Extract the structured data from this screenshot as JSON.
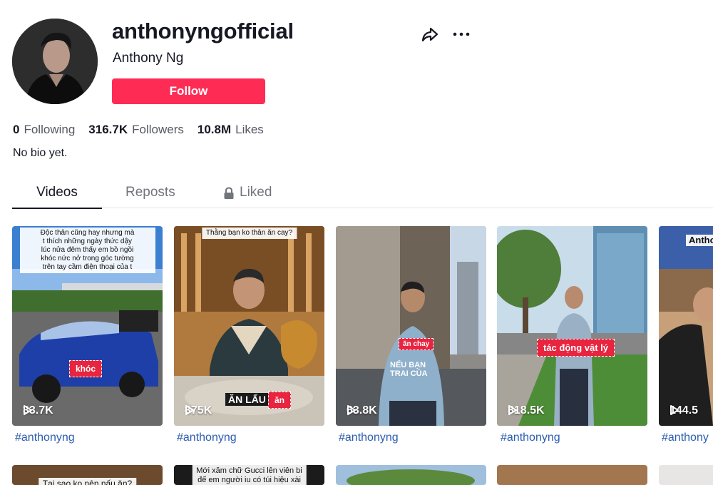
{
  "profile": {
    "username": "anthonyngofficial",
    "nickname": "Anthony Ng",
    "follow_label": "Follow",
    "bio": "No bio yet."
  },
  "stats": [
    {
      "value": "0",
      "label": "Following"
    },
    {
      "value": "316.7K",
      "label": "Followers"
    },
    {
      "value": "10.8M",
      "label": "Likes"
    }
  ],
  "tabs": [
    {
      "label": "Videos",
      "active": true
    },
    {
      "label": "Reposts",
      "active": false
    },
    {
      "label": "Liked",
      "active": false,
      "icon": "lock-icon"
    }
  ],
  "icons": {
    "share": "share-icon",
    "more": "more-icon",
    "play": "play-icon"
  },
  "colors": {
    "accent": "#fe2c55",
    "caption": "#2b5db0"
  },
  "videos": [
    {
      "views": "33.7K",
      "caption": "#anthonyng",
      "overlay": [
        "Độc thân cũng hay nhưng mà",
        "t thích những ngày thức dậy",
        "lúc nửa đêm thấy em bồ ngồi",
        "khóc nức nở trong góc tường",
        "trên tay cầm điện thoại của t"
      ],
      "sticker": "khóc"
    },
    {
      "views": "375K",
      "caption": "#anthonyng",
      "overlay": [
        "Thằng bạn ko thân ăn cay?"
      ],
      "sticker": "ăn",
      "subtitle": "ĂN LẨU"
    },
    {
      "views": "63.8K",
      "caption": "#anthonyng",
      "sticker": "ăn chay",
      "subtitle": "NẾU BẠN TRAI CỦA"
    },
    {
      "views": "818.5K",
      "caption": "#anthonyng",
      "sticker": "tác động vật lý"
    },
    {
      "views": "144.5",
      "caption": "#anthony",
      "overlay": [
        "Antho"
      ]
    }
  ],
  "videos_row2": [
    {
      "overlay": [
        "Tại sao ko nên nấu ăn?"
      ]
    },
    {
      "overlay": [
        "Mới xăm chữ Gucci lên viên bi",
        "để em người iu có túi hiệu xài"
      ]
    },
    {},
    {},
    {}
  ]
}
